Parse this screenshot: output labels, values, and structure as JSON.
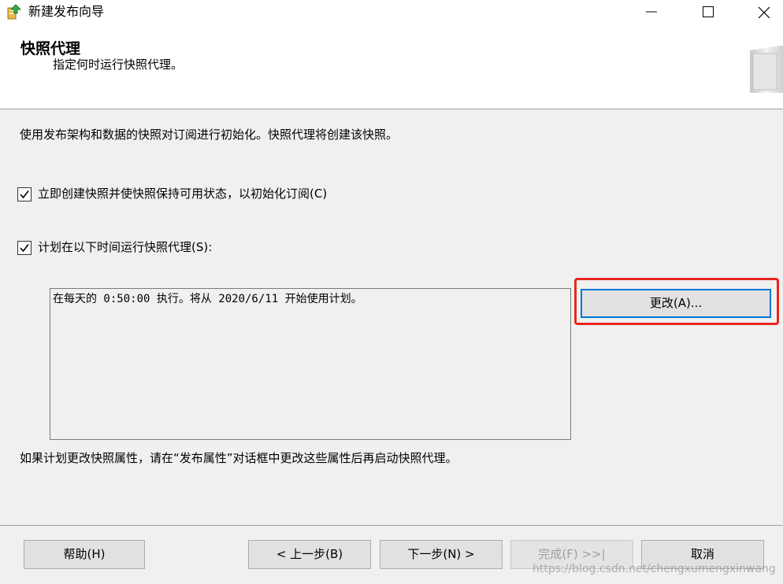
{
  "window": {
    "title": "新建发布向导"
  },
  "header": {
    "title": "快照代理",
    "subtitle": "指定何时运行快照代理。"
  },
  "main": {
    "intro": "使用发布架构和数据的快照对订阅进行初始化。快照代理将创建该快照。",
    "checkbox_create_now": {
      "label": "立即创建快照并使快照保持可用状态，以初始化订阅(C)",
      "checked": true
    },
    "checkbox_schedule": {
      "label": "计划在以下时间运行快照代理(S):",
      "checked": true
    },
    "schedule_text": "在每天的 0:50:00 执行。将从 2020/6/11 开始使用计划。",
    "change_button": "更改(A)...",
    "footnote": "如果计划更改快照属性，请在“发布属性”对话框中更改这些属性后再启动快照代理。"
  },
  "footer": {
    "help": "帮助(H)",
    "back": "< 上一步(B)",
    "next": "下一步(N) >",
    "finish": "完成(F) >>|",
    "cancel": "取消"
  },
  "watermark": "https://blog.csdn.net/chengxumengxinwang",
  "colors": {
    "highlight_border": "#e8261f",
    "focus_border": "#0078d7",
    "background": "#f0f0f0"
  }
}
